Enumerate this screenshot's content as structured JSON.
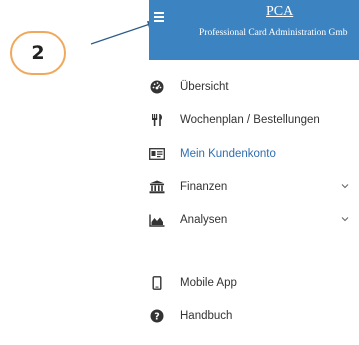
{
  "annotation": {
    "number": "2"
  },
  "header": {
    "menu_icon": "hamburger-icon",
    "brand_abbr": "PCA",
    "brand_full": "Professional Card Administration Gmb",
    "background": "#3c83c2"
  },
  "nav": {
    "items": [
      {
        "label": "Übersicht",
        "icon": "dashboard-icon"
      },
      {
        "label": "Wochenplan / Bestellungen",
        "icon": "cutlery-icon"
      },
      {
        "label": "Mein Kundenkonto",
        "icon": "id-card-icon",
        "active": true
      },
      {
        "label": "Finanzen",
        "icon": "bank-icon",
        "expandable": true
      },
      {
        "label": "Analysen",
        "icon": "area-chart-icon",
        "expandable": true
      },
      {
        "label": "Mobile App",
        "icon": "mobile-icon"
      },
      {
        "label": "Handbuch",
        "icon": "help-circle-icon"
      }
    ],
    "active_color": "#2f6fb0"
  }
}
